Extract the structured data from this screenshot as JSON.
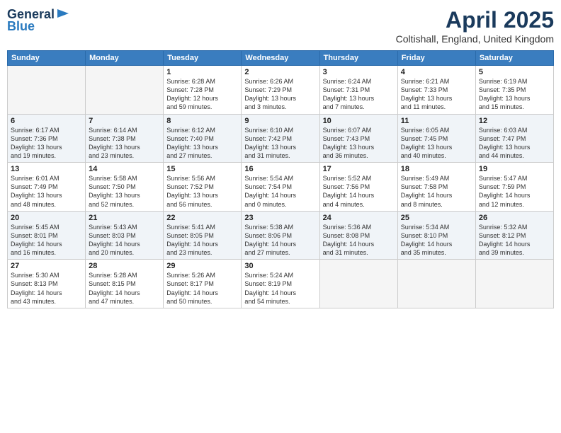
{
  "header": {
    "logo_general": "General",
    "logo_blue": "Blue",
    "title": "April 2025",
    "location": "Coltishall, England, United Kingdom"
  },
  "days_of_week": [
    "Sunday",
    "Monday",
    "Tuesday",
    "Wednesday",
    "Thursday",
    "Friday",
    "Saturday"
  ],
  "weeks": [
    [
      {
        "day": "",
        "info": ""
      },
      {
        "day": "",
        "info": ""
      },
      {
        "day": "1",
        "info": "Sunrise: 6:28 AM\nSunset: 7:28 PM\nDaylight: 12 hours\nand 59 minutes."
      },
      {
        "day": "2",
        "info": "Sunrise: 6:26 AM\nSunset: 7:29 PM\nDaylight: 13 hours\nand 3 minutes."
      },
      {
        "day": "3",
        "info": "Sunrise: 6:24 AM\nSunset: 7:31 PM\nDaylight: 13 hours\nand 7 minutes."
      },
      {
        "day": "4",
        "info": "Sunrise: 6:21 AM\nSunset: 7:33 PM\nDaylight: 13 hours\nand 11 minutes."
      },
      {
        "day": "5",
        "info": "Sunrise: 6:19 AM\nSunset: 7:35 PM\nDaylight: 13 hours\nand 15 minutes."
      }
    ],
    [
      {
        "day": "6",
        "info": "Sunrise: 6:17 AM\nSunset: 7:36 PM\nDaylight: 13 hours\nand 19 minutes."
      },
      {
        "day": "7",
        "info": "Sunrise: 6:14 AM\nSunset: 7:38 PM\nDaylight: 13 hours\nand 23 minutes."
      },
      {
        "day": "8",
        "info": "Sunrise: 6:12 AM\nSunset: 7:40 PM\nDaylight: 13 hours\nand 27 minutes."
      },
      {
        "day": "9",
        "info": "Sunrise: 6:10 AM\nSunset: 7:42 PM\nDaylight: 13 hours\nand 31 minutes."
      },
      {
        "day": "10",
        "info": "Sunrise: 6:07 AM\nSunset: 7:43 PM\nDaylight: 13 hours\nand 36 minutes."
      },
      {
        "day": "11",
        "info": "Sunrise: 6:05 AM\nSunset: 7:45 PM\nDaylight: 13 hours\nand 40 minutes."
      },
      {
        "day": "12",
        "info": "Sunrise: 6:03 AM\nSunset: 7:47 PM\nDaylight: 13 hours\nand 44 minutes."
      }
    ],
    [
      {
        "day": "13",
        "info": "Sunrise: 6:01 AM\nSunset: 7:49 PM\nDaylight: 13 hours\nand 48 minutes."
      },
      {
        "day": "14",
        "info": "Sunrise: 5:58 AM\nSunset: 7:50 PM\nDaylight: 13 hours\nand 52 minutes."
      },
      {
        "day": "15",
        "info": "Sunrise: 5:56 AM\nSunset: 7:52 PM\nDaylight: 13 hours\nand 56 minutes."
      },
      {
        "day": "16",
        "info": "Sunrise: 5:54 AM\nSunset: 7:54 PM\nDaylight: 14 hours\nand 0 minutes."
      },
      {
        "day": "17",
        "info": "Sunrise: 5:52 AM\nSunset: 7:56 PM\nDaylight: 14 hours\nand 4 minutes."
      },
      {
        "day": "18",
        "info": "Sunrise: 5:49 AM\nSunset: 7:58 PM\nDaylight: 14 hours\nand 8 minutes."
      },
      {
        "day": "19",
        "info": "Sunrise: 5:47 AM\nSunset: 7:59 PM\nDaylight: 14 hours\nand 12 minutes."
      }
    ],
    [
      {
        "day": "20",
        "info": "Sunrise: 5:45 AM\nSunset: 8:01 PM\nDaylight: 14 hours\nand 16 minutes."
      },
      {
        "day": "21",
        "info": "Sunrise: 5:43 AM\nSunset: 8:03 PM\nDaylight: 14 hours\nand 20 minutes."
      },
      {
        "day": "22",
        "info": "Sunrise: 5:41 AM\nSunset: 8:05 PM\nDaylight: 14 hours\nand 23 minutes."
      },
      {
        "day": "23",
        "info": "Sunrise: 5:38 AM\nSunset: 8:06 PM\nDaylight: 14 hours\nand 27 minutes."
      },
      {
        "day": "24",
        "info": "Sunrise: 5:36 AM\nSunset: 8:08 PM\nDaylight: 14 hours\nand 31 minutes."
      },
      {
        "day": "25",
        "info": "Sunrise: 5:34 AM\nSunset: 8:10 PM\nDaylight: 14 hours\nand 35 minutes."
      },
      {
        "day": "26",
        "info": "Sunrise: 5:32 AM\nSunset: 8:12 PM\nDaylight: 14 hours\nand 39 minutes."
      }
    ],
    [
      {
        "day": "27",
        "info": "Sunrise: 5:30 AM\nSunset: 8:13 PM\nDaylight: 14 hours\nand 43 minutes."
      },
      {
        "day": "28",
        "info": "Sunrise: 5:28 AM\nSunset: 8:15 PM\nDaylight: 14 hours\nand 47 minutes."
      },
      {
        "day": "29",
        "info": "Sunrise: 5:26 AM\nSunset: 8:17 PM\nDaylight: 14 hours\nand 50 minutes."
      },
      {
        "day": "30",
        "info": "Sunrise: 5:24 AM\nSunset: 8:19 PM\nDaylight: 14 hours\nand 54 minutes."
      },
      {
        "day": "",
        "info": ""
      },
      {
        "day": "",
        "info": ""
      },
      {
        "day": "",
        "info": ""
      }
    ]
  ]
}
